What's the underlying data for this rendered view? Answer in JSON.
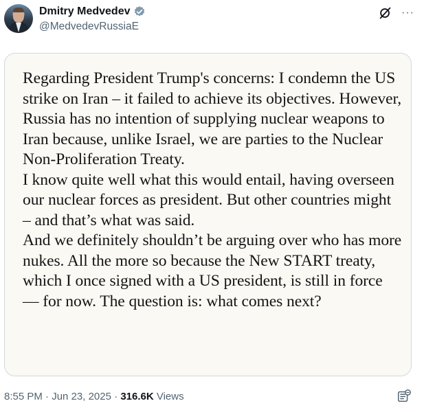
{
  "author": {
    "display_name": "Dmitry Medvedev",
    "handle": "@MedvedevRussiaE",
    "verified_color": "#829aab"
  },
  "header_icons": [
    "grok-icon",
    "more-icon"
  ],
  "more_label": "···",
  "post_image_text": {
    "paragraphs": [
      "Regarding President Trump's concerns: I condemn the US strike on Iran – it failed to achieve its objectives. However, Russia has no intention of supplying nuclear weapons to Iran because, unlike Israel, we are parties to the Nuclear Non-Proliferation Treaty.",
      "I know quite well what this would entail, having overseen our nuclear forces as president. But other countries might – and that’s what was said.",
      "And we definitely shouldn’t be arguing over who has more nukes. All the more so because the New START treaty, which I once signed with a US president, is still in force — for now. The question is: what comes next?"
    ]
  },
  "meta": {
    "time": "8:55 PM",
    "separator": "·",
    "date": "Jun 23, 2025",
    "views_count": "316.6K",
    "views_label": "Views"
  },
  "colors": {
    "primary_text": "#0f1419",
    "secondary_text": "#536471",
    "card_border": "#cfd9de",
    "card_background": "#fbf9f4"
  }
}
